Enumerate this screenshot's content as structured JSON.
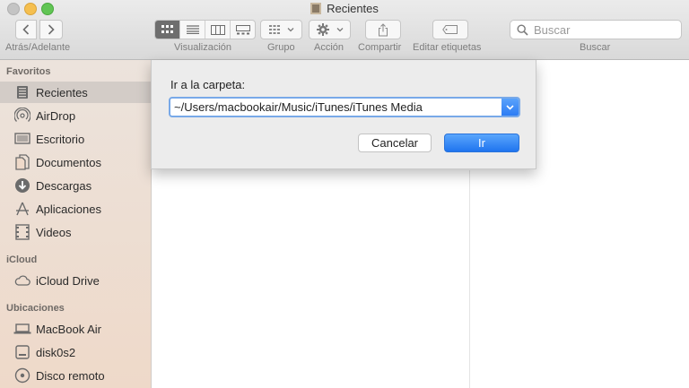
{
  "window": {
    "title": "Recientes"
  },
  "toolbar": {
    "nav_label": "Atrás/Adelante",
    "view_label": "Visualización",
    "group_label": "Grupo",
    "action_label": "Acción",
    "share_label": "Compartir",
    "tags_label": "Editar etiquetas",
    "search_label": "Buscar",
    "search_placeholder": "Buscar",
    "view_active": "icons"
  },
  "sidebar": {
    "favorites_header": "Favoritos",
    "favorites": [
      {
        "label": "Recientes",
        "icon": "recents-icon",
        "selected": true
      },
      {
        "label": "AirDrop",
        "icon": "airdrop-icon"
      },
      {
        "label": "Escritorio",
        "icon": "desktop-icon"
      },
      {
        "label": "Documentos",
        "icon": "documents-icon"
      },
      {
        "label": "Descargas",
        "icon": "downloads-icon"
      },
      {
        "label": "Aplicaciones",
        "icon": "applications-icon"
      },
      {
        "label": "Videos",
        "icon": "movies-icon"
      }
    ],
    "icloud_header": "iCloud",
    "icloud": [
      {
        "label": "iCloud Drive",
        "icon": "cloud-icon"
      }
    ],
    "locations_header": "Ubicaciones",
    "locations": [
      {
        "label": "MacBook Air",
        "icon": "laptop-icon"
      },
      {
        "label": "disk0s2",
        "icon": "disk-icon"
      },
      {
        "label": "Disco remoto",
        "icon": "remote-disc-icon"
      }
    ]
  },
  "dialog": {
    "label": "Ir a la carpeta:",
    "path_value": "~/Users/macbookair/Music/iTunes/iTunes Media",
    "cancel_label": "Cancelar",
    "go_label": "Ir"
  },
  "colors": {
    "accent": "#2c7cf4",
    "sidebar_selected": "#d3ccc7",
    "focus_ring": "#78a9e8"
  }
}
